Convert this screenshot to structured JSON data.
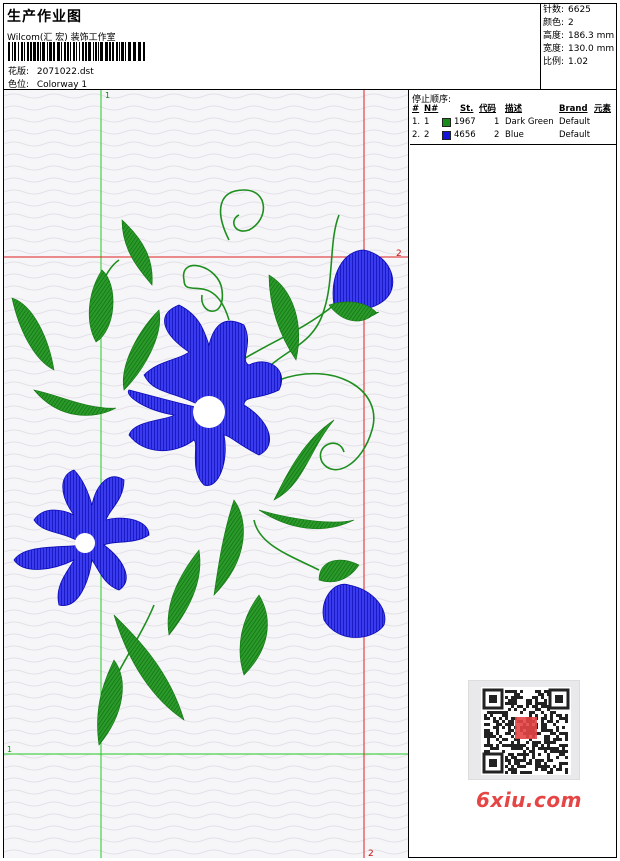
{
  "header": {
    "title": "生产作业图",
    "company": "Wilcom(汇 宏) 装饰工作室",
    "design_label": "花版:",
    "design_value": "2071022.dst",
    "colorway_label": "色位:",
    "colorway_value": "Colorway 1"
  },
  "stats": {
    "stitches_label": "针数:",
    "stitches_value": "6625",
    "colors_label": "颜色:",
    "colors_value": "2",
    "height_label": "高度:",
    "height_value": "186.3 mm",
    "width_label": "宽度:",
    "width_value": "130.0 mm",
    "scale_label": "比例:",
    "scale_value": "1.02"
  },
  "stop_sequence": {
    "title": "停止顺序:",
    "columns": [
      "#",
      "N#",
      "St.",
      "代码",
      "描述",
      "Brand",
      "元素"
    ],
    "rows": [
      {
        "idx": "1.",
        "n": "1",
        "stitches": "1967",
        "code": "1",
        "description": "Dark Green",
        "brand": "Default",
        "color": "#1a8a1a"
      },
      {
        "idx": "2.",
        "n": "2",
        "stitches": "4656",
        "code": "2",
        "description": "Blue",
        "brand": "Default",
        "color": "#1414d8"
      }
    ]
  },
  "guides": {
    "green_label_top": "1",
    "green_label_left": "1",
    "red_label_right": "2",
    "red_label_bottom": "2"
  },
  "colors": {
    "green_thread": "#1e8f1e",
    "blue_thread": "#1a1ad6",
    "green_guide": "#22cc22",
    "red_guide": "#e02020"
  },
  "watermark": "6xiu.com"
}
